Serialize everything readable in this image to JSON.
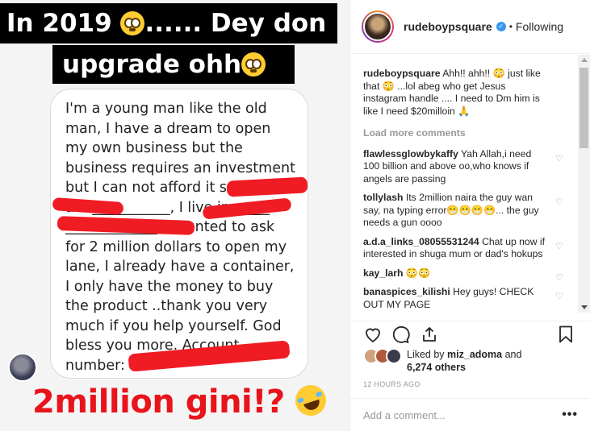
{
  "story": {
    "top_caption_line1": "In 2019",
    "top_caption_line1_tail": "...... Dey don",
    "top_caption_line2": "upgrade ohh",
    "message": "I'm a young man like the old man, I have a dream to open my own business but the business requires an investment but I can not afford it so far, I am ___________, I live in _____ _____________ ,I wanted to ask for 2 million dollars to open my lane, I already have a container, I only have the money to buy the product ..thank you very much if you help yourself. God bless you more. Account number:",
    "bottom_caption": "2million gini!?"
  },
  "post": {
    "username": "rudeboypsquare",
    "follow_status": "Following",
    "verified_mark": "✓",
    "caption_user": "rudeboypsquare",
    "caption_text": "Ahh!! ahh!! 😳 just like that 😳 ...lol abeg who get Jesus instagram handle .... I need to Dm him is like I need $20milloin 🙏",
    "load_more": "Load more comments",
    "comments": [
      {
        "user": "flawlessglowbykaffy",
        "text": "Yah Allah,i need 100 billion and above oo,who knows if angels are passing"
      },
      {
        "user": "tollylash",
        "text": "Its 2million naira the guy wan say, na typing error😁😁😁😁... the guy needs a gun oooo"
      },
      {
        "user": "a.d.a_links_08055531244",
        "text": "Chat up now if interested in shuga mum or dad's hokups"
      },
      {
        "user": "kay_larh",
        "text": "😳😳"
      },
      {
        "user": "banaspices_kilishi",
        "text": "Hey guys! CHECK OUT MY PAGE"
      }
    ],
    "liked_by_prefix": "Liked by ",
    "liked_by_user": "miz_adoma",
    "liked_by_and": " and",
    "likes_count": "6,274 others",
    "timestamp": "12 HOURS AGO",
    "add_comment_placeholder": "Add a comment...",
    "more_options": "•••",
    "heart_glyph": "♡"
  }
}
